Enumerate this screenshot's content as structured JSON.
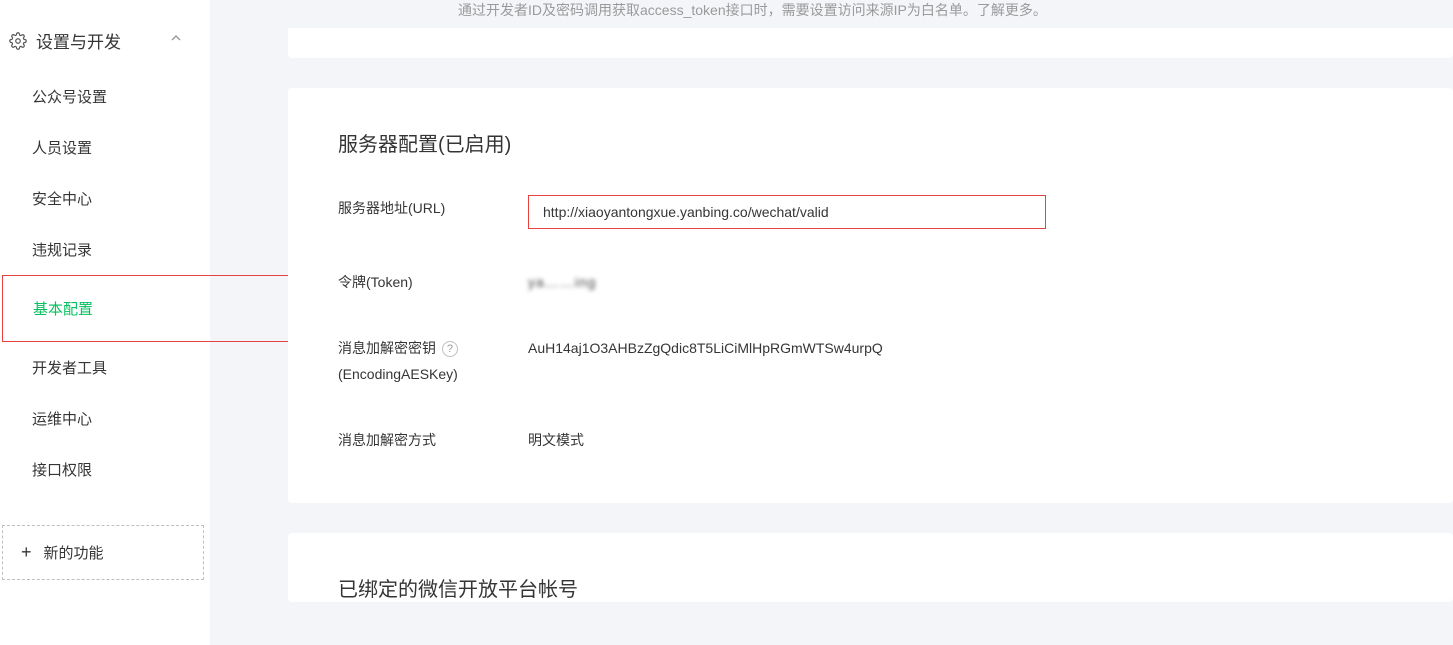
{
  "sidebar": {
    "section_title": "设置与开发",
    "items": [
      {
        "label": "公众号设置",
        "active": false
      },
      {
        "label": "人员设置",
        "active": false
      },
      {
        "label": "安全中心",
        "active": false
      },
      {
        "label": "违规记录",
        "active": false
      },
      {
        "label": "基本配置",
        "active": true
      },
      {
        "label": "开发者工具",
        "active": false
      },
      {
        "label": "运维中心",
        "active": false
      },
      {
        "label": "接口权限",
        "active": false
      }
    ],
    "new_feature_label": "新的功能"
  },
  "top_banner_fragment": "通过开发者ID及密码调用获取access_token接口时，需要设置访问来源IP为白名单。了解更多。",
  "server_config": {
    "title": "服务器配置(已启用)",
    "url_label": "服务器地址(URL)",
    "url_value": "http://xiaoyantongxue.yanbing.co/wechat/valid",
    "token_label": "令牌(Token)",
    "token_value": "ya……ing",
    "aeskey_label_line1": "消息加解密密钥",
    "aeskey_label_line2": "(EncodingAESKey)",
    "aeskey_value": "AuH14aj1O3AHBzZgQdic8T5LiCiMlHpRGmWTSw4urpQ",
    "mode_label": "消息加解密方式",
    "mode_value": "明文模式"
  },
  "bound_section": {
    "title": "已绑定的微信开放平台帐号"
  }
}
